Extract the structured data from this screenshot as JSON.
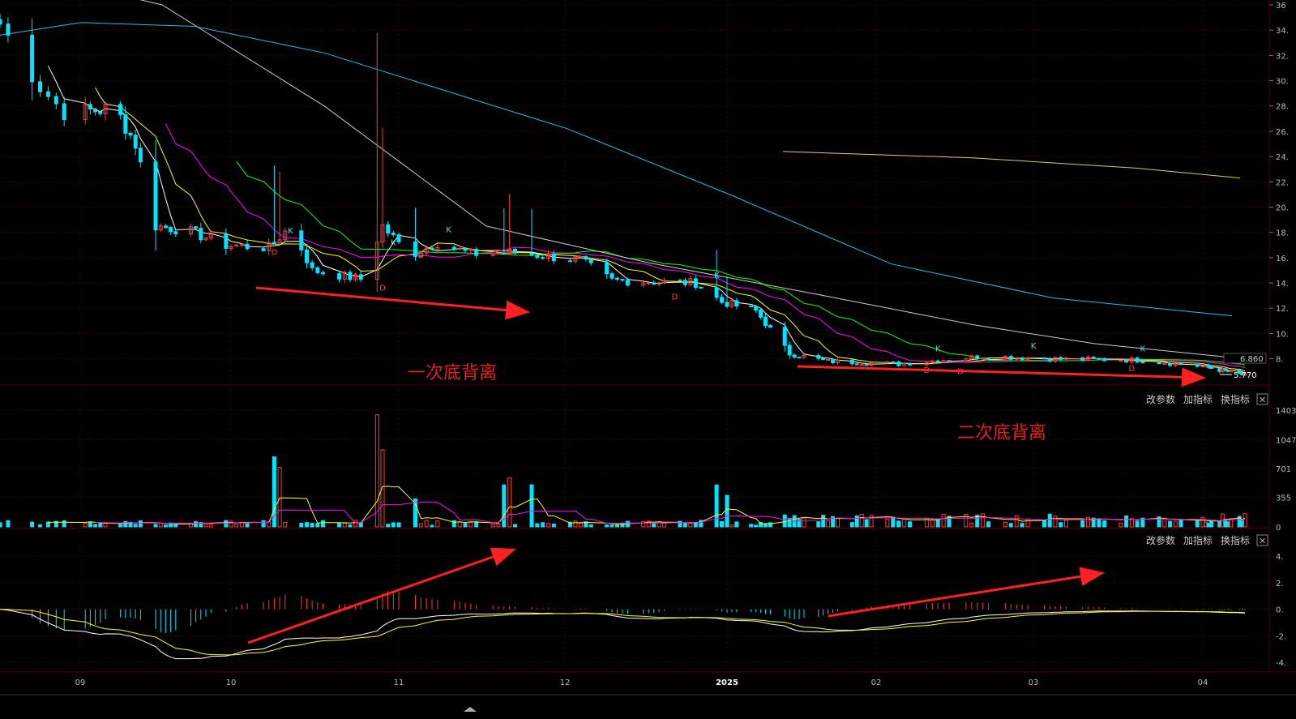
{
  "colors": {
    "up": "#ff3b3b",
    "down": "#00e5ff",
    "ma5": "#ffffff",
    "ma10": "#ffff00",
    "ma20": "#ff00ff",
    "ma30": "#00ff00",
    "ma60": "#cccccc",
    "ma120": "#20c0e0",
    "ma250": "#d8d060",
    "annotation": "#ff2020",
    "grid": "#3a0000",
    "axis_text": "#bbbbbb"
  },
  "toolbar": {
    "edit_params": "改参数",
    "add_indicator": "加指标",
    "switch_indicator": "换指标",
    "close_glyph": "✕"
  },
  "annotations": {
    "first_divergence": "一次底背离",
    "second_divergence": "二次底背离",
    "last_price": "5.770",
    "ref_price": "6.860"
  },
  "chart_data": [
    {
      "type": "candlestick",
      "title": "",
      "x_labels": [
        "09",
        "10",
        "11",
        "12",
        "2025",
        "02",
        "03",
        "04"
      ],
      "y_ticks": [
        "36",
        "34.",
        "32.",
        "30.",
        "28.",
        "26.",
        "24.",
        "22.",
        "20.",
        "18.",
        "16.",
        "14.",
        "12.",
        "10.",
        "8."
      ],
      "ylim": [
        6.5,
        36
      ],
      "buy_sell_markers": [
        {
          "label": "K",
          "date": "2024-10-12",
          "price": 17.9
        },
        {
          "label": "D",
          "date": "2024-10-09",
          "price": 16.2
        },
        {
          "label": "D",
          "date": "2024-10-29",
          "price": 13.4
        },
        {
          "label": "K",
          "date": "2024-10-31",
          "price": 17.0
        },
        {
          "label": "D",
          "date": "2024-11-05",
          "price": 16.0
        },
        {
          "label": "K",
          "date": "2024-11-10",
          "price": 18.0
        },
        {
          "label": "D",
          "date": "2024-12-22",
          "price": 12.7
        },
        {
          "label": "K",
          "date": "2024-12-30",
          "price": 14.4
        },
        {
          "label": "D",
          "date": "2025-02-10",
          "price": 6.9
        },
        {
          "label": "K",
          "date": "2025-02-12",
          "price": 8.6
        },
        {
          "label": "D",
          "date": "2025-02-16",
          "price": 6.8
        },
        {
          "label": "K",
          "date": "2025-03-01",
          "price": 8.8
        },
        {
          "label": "D",
          "date": "2025-03-19",
          "price": 7.0
        },
        {
          "label": "K",
          "date": "2025-03-21",
          "price": 8.6
        }
      ]
    },
    {
      "type": "bar",
      "title": "",
      "y_ticks": [
        "1403",
        "1047",
        "701",
        "355",
        "0"
      ],
      "ylim": [
        0,
        1403
      ]
    },
    {
      "type": "bar",
      "title": "",
      "y_ticks": [
        "4.",
        "2.",
        "0.",
        "-2.",
        "-4."
      ],
      "ylim": [
        -4.3,
        4.5
      ]
    }
  ]
}
